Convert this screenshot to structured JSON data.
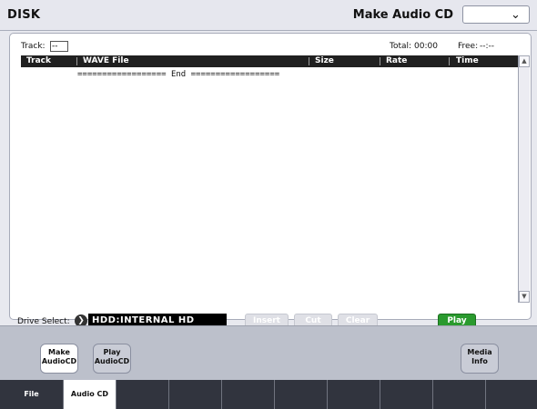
{
  "header": {
    "mode": "DISK",
    "page": "Make Audio CD",
    "menu_icon": "chevron-down-icon"
  },
  "panel": {
    "track_label": "Track:",
    "track_value": "--",
    "total_label": "Total:",
    "total_value": "00:00",
    "free_label": "Free:",
    "free_value": "--:--",
    "columns": [
      "Track",
      "WAVE File",
      "Size",
      "Rate",
      "Time"
    ],
    "end_marker": "================== End ==================",
    "scroll_up_icon": "scroll-up-arrow-icon",
    "scroll_down_icon": "scroll-down-arrow-icon"
  },
  "drive": {
    "label": "Drive Select:",
    "value": "HDD:INTERNAL HD"
  },
  "buttons": {
    "insert": "Insert",
    "cut": "Cut",
    "clear": "Clear",
    "play": "Play"
  },
  "sub_tabs": [
    {
      "line1": "Make",
      "line2": "AudioCD"
    },
    {
      "line1": "Play",
      "line2": "AudioCD"
    },
    {
      "line1": "Media",
      "line2": "Info"
    }
  ],
  "main_tabs": [
    "File",
    "Audio CD"
  ],
  "colors": {
    "play_button": "#2a9a2e",
    "list_header": "#202020",
    "tab_bar": "#31343e"
  }
}
